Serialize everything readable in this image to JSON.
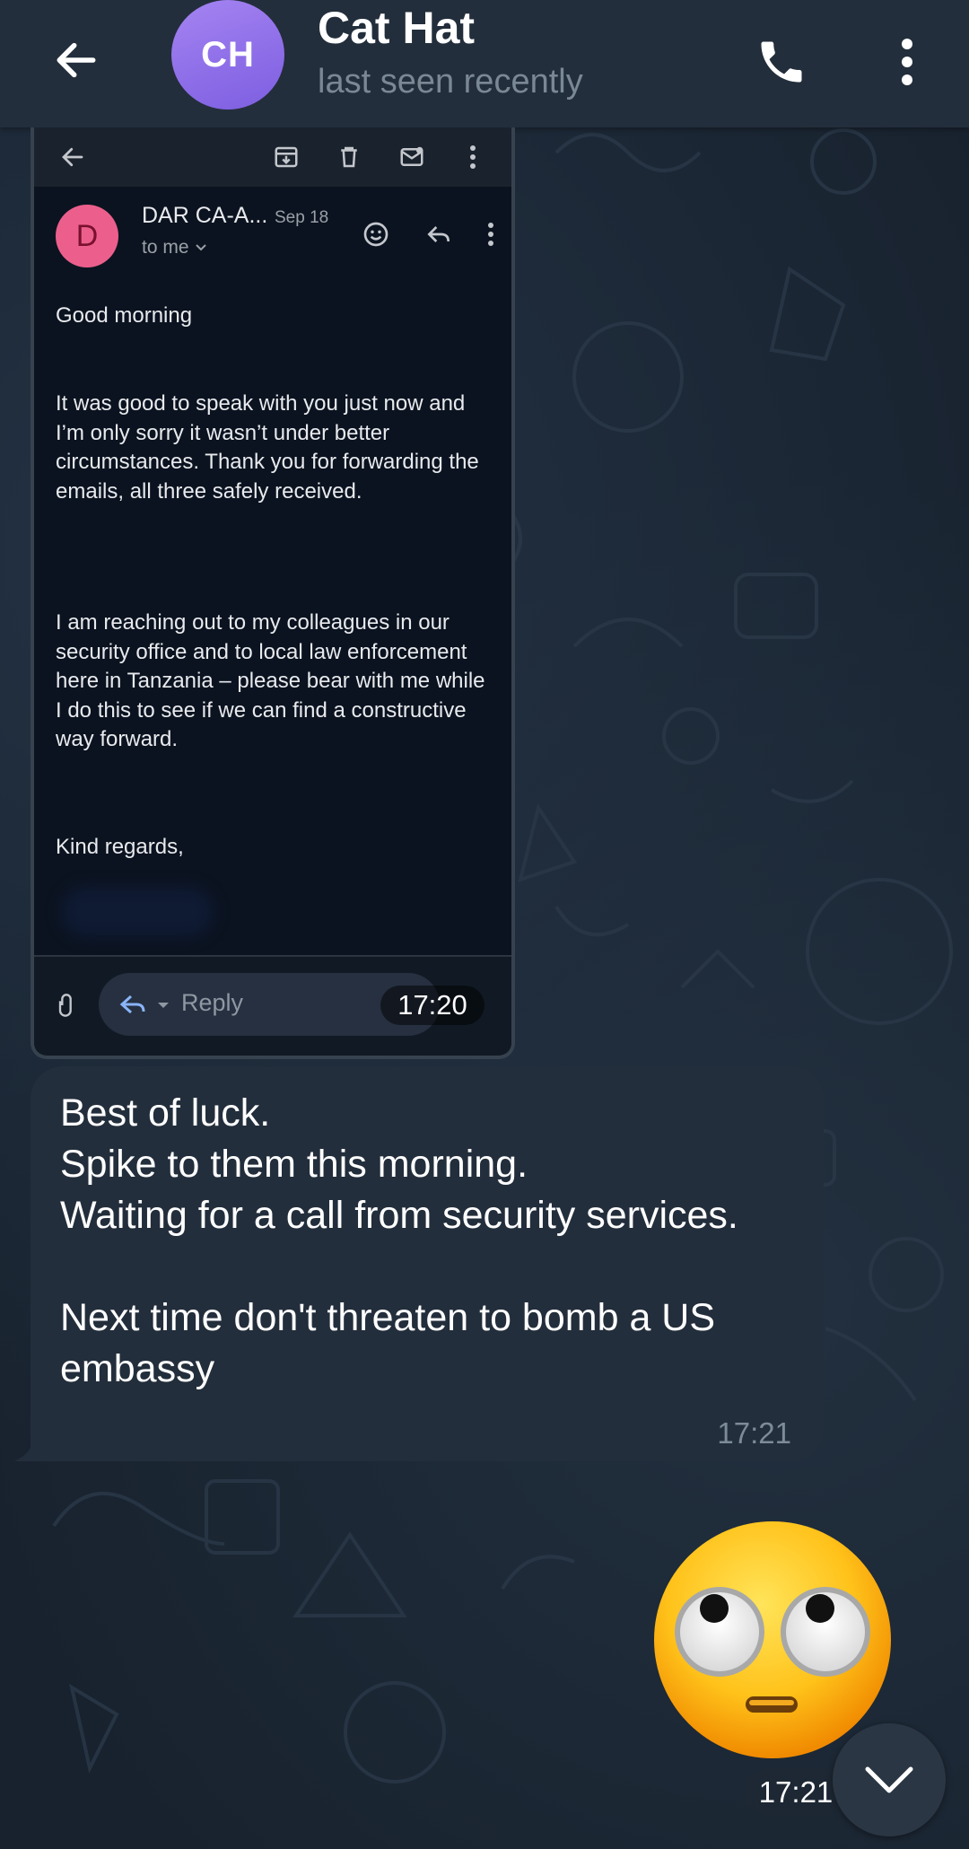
{
  "chat": {
    "title": "Cat Hat",
    "status": "last seen recently",
    "avatar_initials": "CH",
    "avatar_color": "#8f6cea"
  },
  "email_screenshot": {
    "sender_initial": "D",
    "sender_name": "DAR CA-A...",
    "date": "Sep 18",
    "recipient": "to me",
    "paragraphs": [
      "Good morning",
      "It was good to speak with you just now and I’m only sorry it wasn’t under better circumstances.  Thank you for forwarding the emails, all three safely received.",
      "I am reaching out to my colleagues in our security office and to local law enforcement here in Tanzania – please bear with me while I do this to see if we can find a constructive way forward.",
      "Kind regards,"
    ],
    "reply_label": "Reply",
    "time": "17:20"
  },
  "text_message": {
    "text": "Best of luck.\nSpike to them this morning.\nWaiting for a call from security services.\n\nNext time don't threaten to bomb a US embassy",
    "time": "17:21"
  },
  "emoji_message": {
    "emoji": "face-with-rolling-eyes",
    "time": "17:21"
  },
  "colors": {
    "header": "#232e3c",
    "bubble": "#232e3c",
    "background": "#18222e"
  }
}
